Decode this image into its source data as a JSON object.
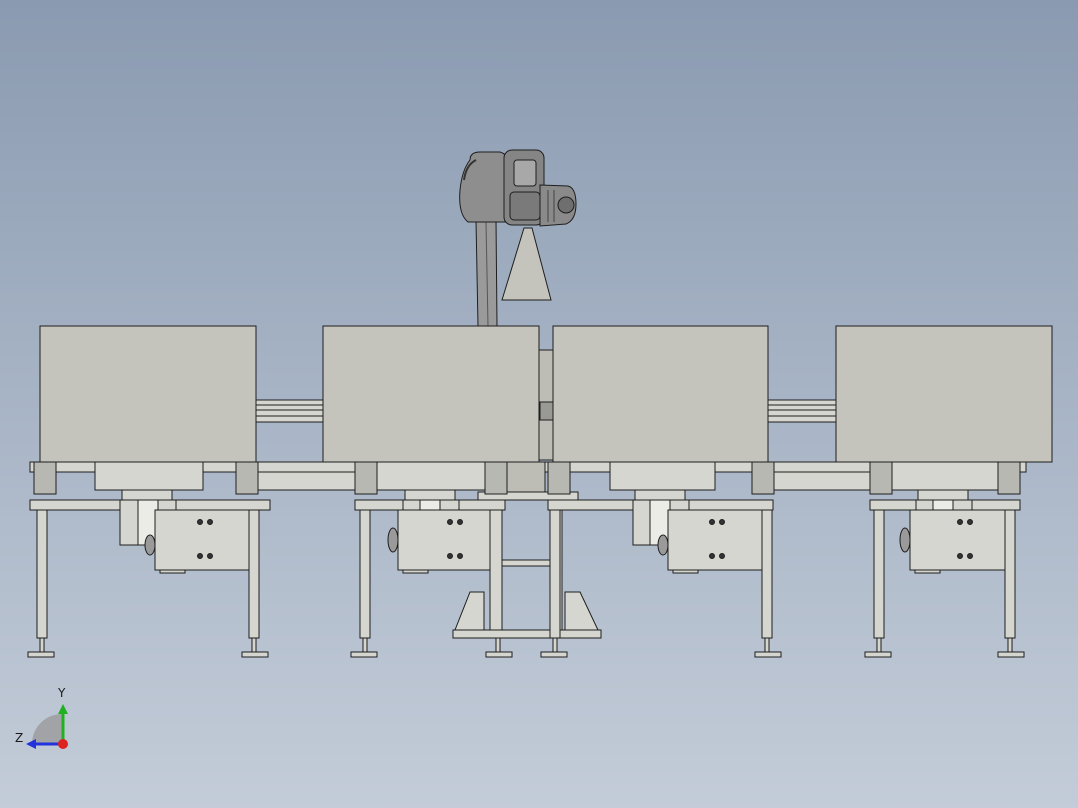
{
  "viewport": {
    "background_top": "#8a9ab0",
    "background_bottom": "#c3ccd8"
  },
  "model": {
    "description_icon": "robot-conveyor-assembly",
    "panel_fill": "#c4c3bc",
    "line_color": "#1e1e1e",
    "metal_fill": "#d6d6d0",
    "robot_fill": "#8c8c8c",
    "station_count": 4
  },
  "triad": {
    "y_label": "Y",
    "z_label": "Z",
    "y_color": "#22b022",
    "z_color": "#2233dd",
    "x_color": "#dd2222"
  }
}
